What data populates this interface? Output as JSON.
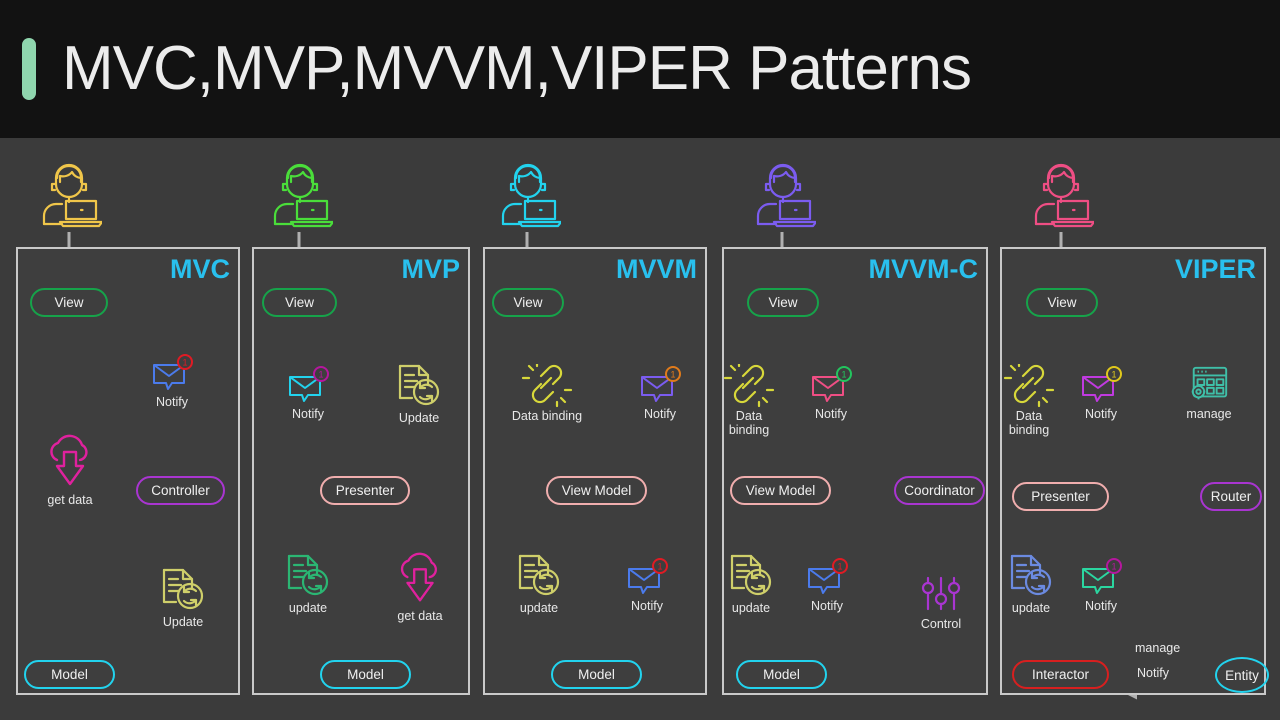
{
  "header": {
    "title": "MVC,MVP,MVVM,VIPER Patterns",
    "accent_color": "#8fd6ae",
    "background": "#121212"
  },
  "canvas": {
    "background": "#3b3b3b",
    "panel_background": "#3e3e3e",
    "panel_border": "#c9c9c9",
    "arrow_color": "#b0b0b0",
    "title_color": "#29c0ee"
  },
  "panels": [
    {
      "id": "mvc",
      "title": "MVC",
      "avatar_color": "#f0c64a",
      "nodes": [
        {
          "label": "View",
          "color": "#16a34a"
        },
        {
          "label": "Controller",
          "color": "#a935d1"
        },
        {
          "label": "Model",
          "color": "#22d3ee"
        }
      ],
      "icons": [
        {
          "name": "notify-envelope-icon",
          "caption": "Notify",
          "color": "#4b7bec",
          "badge": "1",
          "badge_color": "#e01b24"
        },
        {
          "name": "get-data-cloud-icon",
          "caption": "get data",
          "color": "#e0219e"
        },
        {
          "name": "update-document-refresh-icon",
          "caption": "Update",
          "color": "#cfcf6a"
        }
      ]
    },
    {
      "id": "mvp",
      "title": "MVP",
      "avatar_color": "#4ade3a",
      "nodes": [
        {
          "label": "View",
          "color": "#16a34a"
        },
        {
          "label": "Presenter",
          "color": "#f0aeae"
        },
        {
          "label": "Model",
          "color": "#22d3ee"
        }
      ],
      "icons": [
        {
          "name": "notify-envelope-icon",
          "caption": "Notify",
          "color": "#22d3ee",
          "badge": "1",
          "badge_color": "#b5179e"
        },
        {
          "name": "update-document-refresh-icon",
          "caption": "Update",
          "color": "#cfcf6a"
        },
        {
          "name": "update-document-refresh-icon",
          "caption": "update",
          "color": "#2bb673"
        },
        {
          "name": "get-data-cloud-icon",
          "caption": "get data",
          "color": "#e0219e"
        }
      ]
    },
    {
      "id": "mvvm",
      "title": "MVVM",
      "avatar_color": "#22d3ee",
      "nodes": [
        {
          "label": "View",
          "color": "#16a34a"
        },
        {
          "label": "View Model",
          "color": "#f0aeae"
        },
        {
          "label": "Model",
          "color": "#22d3ee"
        }
      ],
      "icons": [
        {
          "name": "data-binding-chain-icon",
          "caption": "Data binding",
          "color": "#d8d83a"
        },
        {
          "name": "notify-envelope-icon",
          "caption": "Notify",
          "color": "#7b5cf0",
          "badge": "1",
          "badge_color": "#e07b1b"
        },
        {
          "name": "update-document-refresh-icon",
          "caption": "update",
          "color": "#cfcf6a"
        },
        {
          "name": "notify-envelope-icon",
          "caption": "Notify",
          "color": "#4b7bec",
          "badge": "1",
          "badge_color": "#e01b24"
        }
      ]
    },
    {
      "id": "mvvmc",
      "title": "MVVM-C",
      "avatar_color": "#7b5cf0",
      "nodes": [
        {
          "label": "View",
          "color": "#16a34a"
        },
        {
          "label": "View Model",
          "color": "#f0aeae"
        },
        {
          "label": "Coordinator",
          "color": "#a935d1"
        },
        {
          "label": "Model",
          "color": "#22d3ee"
        }
      ],
      "icons": [
        {
          "name": "data-binding-chain-icon",
          "caption": "Data\nbinding",
          "color": "#d8d83a"
        },
        {
          "name": "notify-envelope-icon",
          "caption": "Notify",
          "color": "#ef4e84",
          "badge": "1",
          "badge_color": "#22c55e"
        },
        {
          "name": "update-document-refresh-icon",
          "caption": "update",
          "color": "#cfcf6a"
        },
        {
          "name": "notify-envelope-icon",
          "caption": "Notify",
          "color": "#4b7bec",
          "badge": "1",
          "badge_color": "#e01b24"
        },
        {
          "name": "control-sliders-icon",
          "caption": "Control",
          "color": "#a935d1"
        }
      ]
    },
    {
      "id": "viper",
      "title": "VIPER",
      "avatar_color": "#ef4e84",
      "nodes": [
        {
          "label": "View",
          "color": "#16a34a"
        },
        {
          "label": "Presenter",
          "color": "#f0aeae"
        },
        {
          "label": "Router",
          "color": "#a935d1"
        },
        {
          "label": "Interactor",
          "color": "#d81f1f"
        },
        {
          "label": "Entity",
          "color": "#22d3ee"
        }
      ],
      "icons": [
        {
          "name": "data-binding-chain-icon",
          "caption": "Data\nbinding",
          "color": "#d8d83a"
        },
        {
          "name": "notify-envelope-icon",
          "caption": "Notify",
          "color": "#c03ae0",
          "badge": "1",
          "badge_color": "#e0c81b"
        },
        {
          "name": "manage-window-gear-icon",
          "caption": "manage",
          "color": "#3fbfa8"
        },
        {
          "name": "update-document-refresh-icon",
          "caption": "update",
          "color": "#6b8ae0"
        },
        {
          "name": "notify-envelope-icon",
          "caption": "Notify",
          "color": "#2bd6a0",
          "badge": "1",
          "badge_color": "#b5179e"
        }
      ],
      "edge_labels": [
        "manage",
        "Notify"
      ]
    }
  ]
}
